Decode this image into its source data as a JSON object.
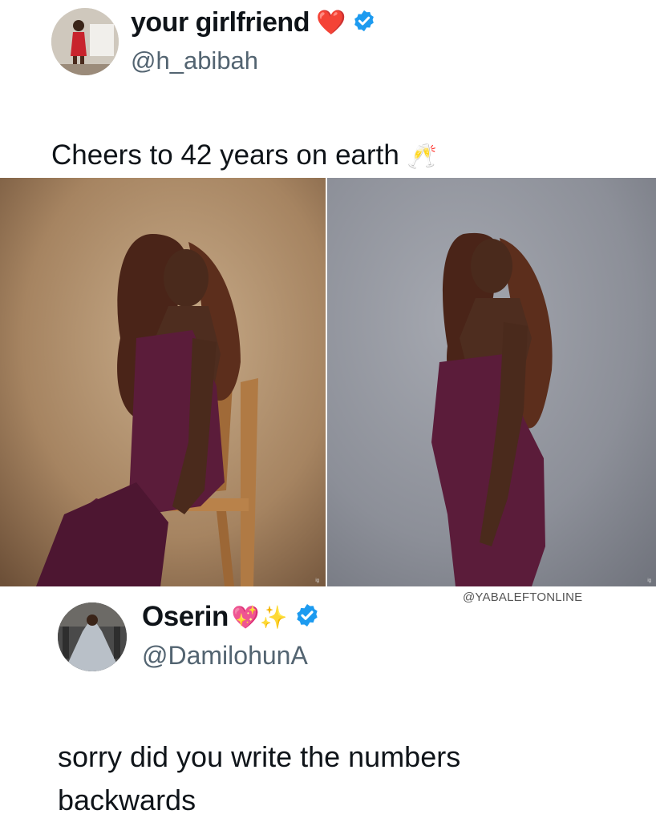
{
  "post": {
    "author": {
      "display_name": "your girlfriend",
      "emoji": "❤️",
      "handle": "@h_abibah",
      "verified_icon": "verified-badge-icon"
    },
    "text": "Cheers to 42 years on earth",
    "text_emoji": "🥂",
    "photos": [
      {
        "background": "#b08f6d",
        "dress": "#5b1c3a"
      },
      {
        "background": "#8f929a",
        "dress": "#5b1c3a"
      }
    ],
    "watermark": "@YABALEFTONLINE"
  },
  "reply": {
    "author": {
      "display_name": "Oserin",
      "emoji": "💖✨",
      "handle": "@DamilohunA",
      "verified_icon": "verified-badge-icon"
    },
    "text_line1": "sorry did you write the numbers",
    "text_line2": "backwards"
  },
  "colors": {
    "verified_blue": "#1d9bf0",
    "handle_gray": "#536471",
    "heart_red": "#e0245e"
  }
}
